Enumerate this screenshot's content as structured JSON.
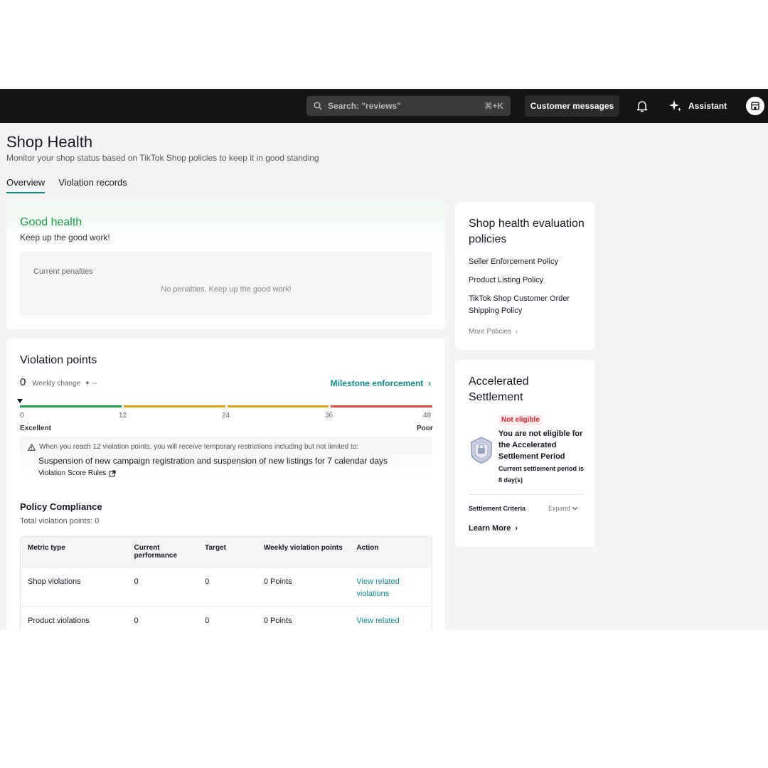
{
  "topbar": {
    "search_placeholder": "Search: \"reviews\"",
    "search_shortcut": "⌘+K",
    "customer_messages": "Customer messages",
    "assistant": "Assistant"
  },
  "header": {
    "title": "Shop Health",
    "subtitle": "Monitor your shop status based on TikTok Shop policies to keep it in good standing",
    "tabs": [
      "Overview",
      "Violation records"
    ]
  },
  "health": {
    "status": "Good health",
    "message": "Keep up the good work!",
    "penalties_label": "Current penalties",
    "penalties_message": "No penalties. Keep up the good work!"
  },
  "violations": {
    "title": "Violation points",
    "points": "0",
    "weekly_change_label": "Weekly change",
    "weekly_change_value": "--",
    "milestone_link": "Milestone enforcement",
    "ticks": [
      "0",
      "12",
      "24",
      "36",
      "48"
    ],
    "level_low": "Excellent",
    "level_high": "Poor",
    "segment_colors": [
      "#1e9e4a",
      "#e0a417",
      "#e0a417",
      "#e04a4a"
    ],
    "warning_intro": "When you reach 12 violation points, you will receive temporary restrictions including but not limited to:",
    "warning_detail": "Suspension of new campaign registration and suspension of new listings for 7 calendar days",
    "rules_link": "Violation Score Rules"
  },
  "compliance": {
    "title": "Policy Compliance",
    "total": "Total violation points: 0",
    "columns": [
      "Metric type",
      "Current performance",
      "Target",
      "Weekly violation points",
      "Action"
    ],
    "rows": [
      {
        "metric": "Shop violations",
        "current": "0",
        "target": "0",
        "weekly": "0 Points",
        "action": "View related violations"
      },
      {
        "metric": "Product violations",
        "current": "0",
        "target": "0",
        "weekly": "0 Points",
        "action": "View related violations"
      }
    ]
  },
  "policies": {
    "title": "Shop health evaluation policies",
    "items": [
      "Seller Enforcement Policy",
      "Product Listing Policy",
      "TikTok Shop Customer Order Shipping Policy"
    ],
    "more": "More Policies"
  },
  "settlement": {
    "title": "Accelerated Settlement",
    "badge": "Not eligible",
    "message": "You are not eligible for the Accelerated Settlement Period",
    "period": "Current settlement period is 8 day(s)",
    "criteria": "Settlement Criteria",
    "expand": "Expand",
    "learn_more": "Learn More"
  },
  "colors": {
    "accent": "#128a8a",
    "good": "#1e9e4a",
    "danger": "#e0282e",
    "topbar": "#141414"
  }
}
